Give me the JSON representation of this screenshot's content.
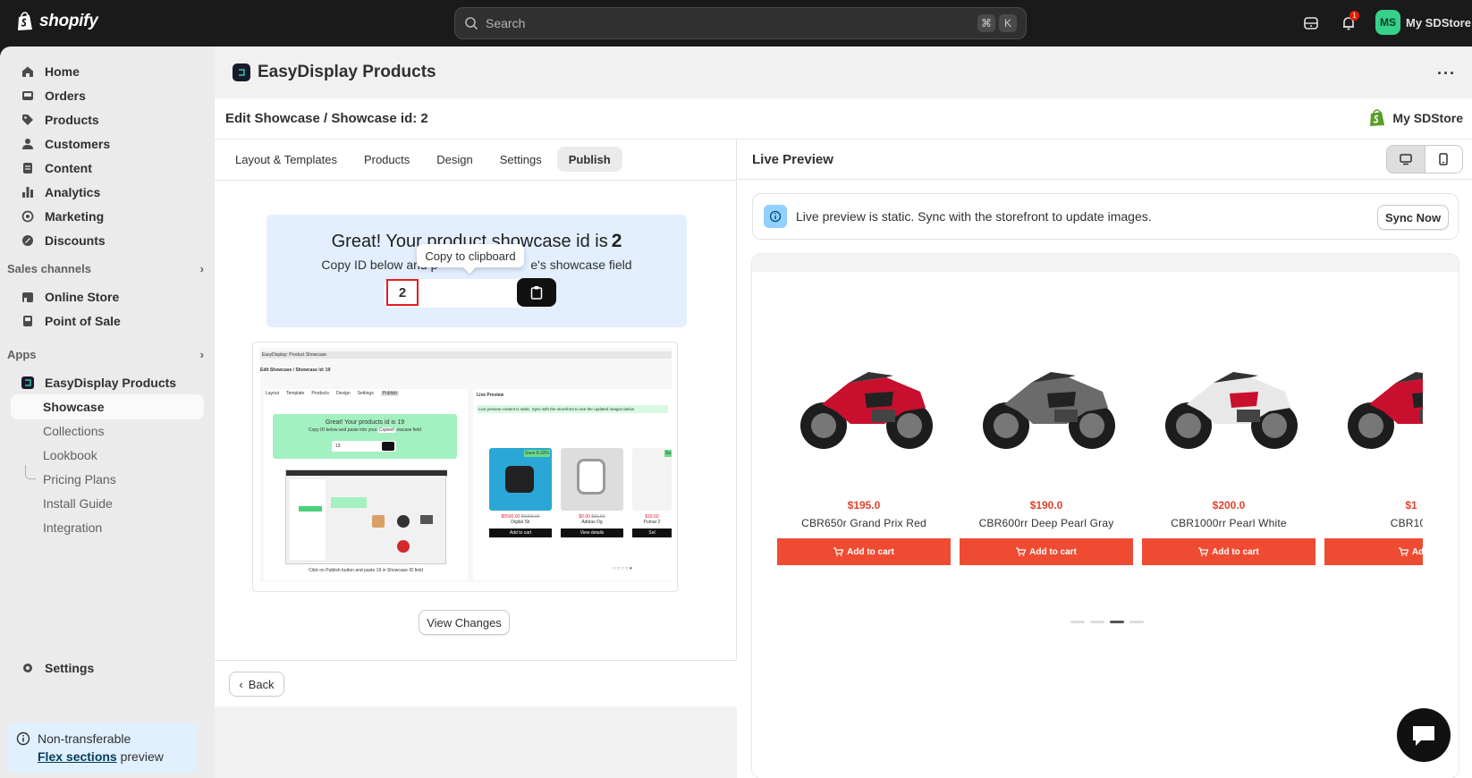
{
  "topbar": {
    "brand": "shopify",
    "search_placeholder": "Search",
    "shortcut_keys": [
      "⌘",
      "K"
    ],
    "notification_count": "1",
    "avatar_initials": "MS",
    "store_name": "My SDStore"
  },
  "sidebar": {
    "items": [
      {
        "label": "Home",
        "icon": "home-icon"
      },
      {
        "label": "Orders",
        "icon": "inbox-icon"
      },
      {
        "label": "Products",
        "icon": "tag-icon"
      },
      {
        "label": "Customers",
        "icon": "person-icon"
      },
      {
        "label": "Content",
        "icon": "document-icon"
      },
      {
        "label": "Analytics",
        "icon": "bar-chart-icon"
      },
      {
        "label": "Marketing",
        "icon": "target-icon"
      },
      {
        "label": "Discounts",
        "icon": "discount-icon"
      }
    ],
    "sales_channels_label": "Sales channels",
    "channels": [
      {
        "label": "Online Store",
        "icon": "store-icon"
      },
      {
        "label": "Point of Sale",
        "icon": "pos-icon"
      }
    ],
    "apps_label": "Apps",
    "app_name": "EasyDisplay Products",
    "app_subitems": [
      "Showcase",
      "Collections",
      "Lookbook",
      "Pricing Plans",
      "Install Guide",
      "Integration"
    ],
    "settings_label": "Settings",
    "flex_card": {
      "line1": "Non-transferable",
      "link": "Flex sections",
      "suffix": "preview"
    }
  },
  "app": {
    "title": "EasyDisplay Products",
    "edit_title": "Edit Showcase / Showcase id: 2",
    "store_name": "My SDStore",
    "tabs": [
      "Layout & Templates",
      "Products",
      "Design",
      "Settings",
      "Publish"
    ],
    "active_tab": "Publish",
    "success": {
      "headline": "Great! Your product showcase id is",
      "id": "2",
      "subtext_start": "Copy ID below and p",
      "subtext_end": "e's showcase field",
      "tooltip": "Copy to clipboard"
    },
    "guide": {
      "app_bar": "EasyDisplay: Product Showcase",
      "edit_title": "Edit Showcase / Showcase id: 19",
      "tabs": [
        "Layout",
        "Template",
        "Products",
        "Design",
        "Settings",
        "Publish"
      ],
      "live_preview": "Live Preview",
      "banner": "Live preview content is static. Sync with the storefront to see the updated images below",
      "headline": "Great! Your products id is 19",
      "subtext": "Copy ID below and paste into your",
      "copied": "Copied!",
      "field_suffix": "owcase field",
      "id": "19",
      "footer": "Click on Publish button and paste 19 in Showcase ID field",
      "cards": [
        {
          "price": "$5500.00",
          "old": "$6000.00",
          "name": "Digital Slr",
          "btn": "Add to cart",
          "badge": "Save 8.33%"
        },
        {
          "price": "$0.00",
          "old": "$31.50",
          "name": "Adidas Og",
          "btn": "View details",
          "badge": ""
        },
        {
          "price": "$16.50",
          "old": "",
          "name": "Pumar 2",
          "btn": "Sol",
          "badge": "Sa"
        }
      ]
    },
    "view_changes": "View Changes",
    "back": "Back"
  },
  "preview": {
    "title": "Live Preview",
    "banner_text": "Live preview is static. Sync with the storefront to update images.",
    "sync_button": "Sync Now",
    "products": [
      {
        "price": "$195.0",
        "name": "CBR650r Grand Prix Red",
        "button": "Add to cart",
        "color": "#c8102e"
      },
      {
        "price": "$190.0",
        "name": "CBR600rr Deep Pearl Gray",
        "button": "Add to cart",
        "color": "#6b6b6b"
      },
      {
        "price": "$200.0",
        "name": "CBR1000rr Pearl White",
        "button": "Add to cart",
        "color": "#e8e8e8"
      },
      {
        "price": "$1",
        "name": "CBR100",
        "button": "Ad",
        "color": "#c8102e"
      }
    ],
    "active_dot": 3
  }
}
